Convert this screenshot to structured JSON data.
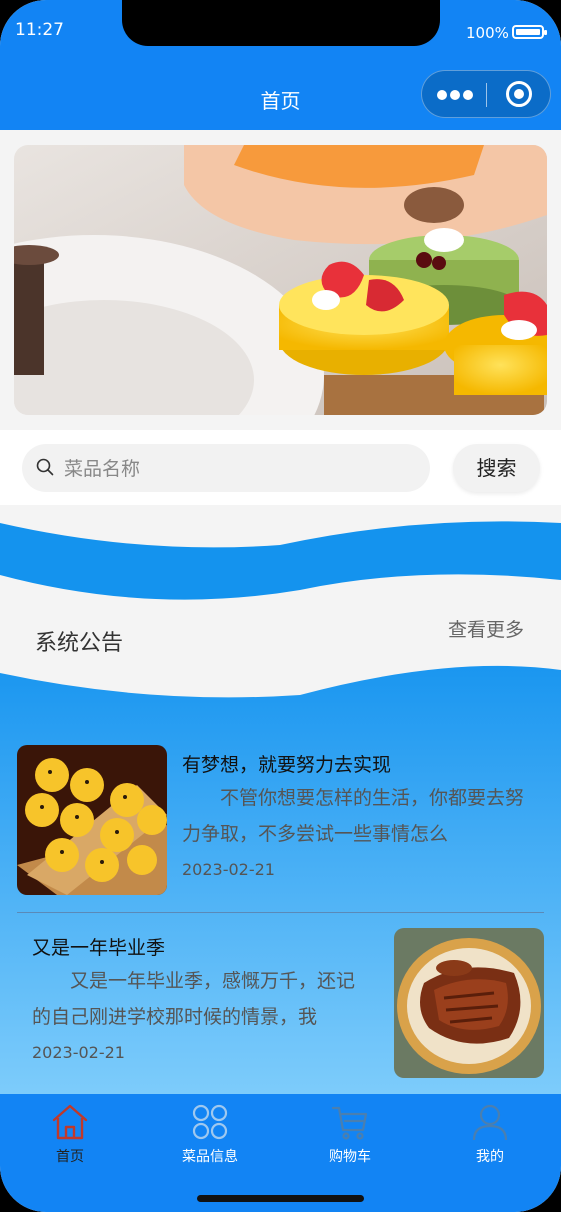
{
  "status_bar": {
    "time": "11:27",
    "battery": "100%"
  },
  "nav": {
    "title": "首页"
  },
  "search": {
    "placeholder": "菜品名称",
    "button_label": "搜索"
  },
  "notice": {
    "title": "系统公告",
    "more_label": "查看更多"
  },
  "articles": [
    {
      "title": "有梦想，就要努力去实现",
      "summary": "不管你想要怎样的生活，你都要去努力争取，不多尝试一些事情怎么",
      "date": "2023-02-21"
    },
    {
      "title": "又是一年毕业季",
      "summary": "又是一年毕业季，感慨万千，还记的自己刚进学校那时候的情景，我",
      "date": "2023-02-21"
    }
  ],
  "tabbar": {
    "items": [
      {
        "label": "首页",
        "icon": "home-icon"
      },
      {
        "label": "菜品信息",
        "icon": "grid-icon"
      },
      {
        "label": "购物车",
        "icon": "cart-icon"
      },
      {
        "label": "我的",
        "icon": "user-icon"
      }
    ],
    "active_index": 0
  },
  "colors": {
    "primary": "#1284f4",
    "active_icon": "#c0392b"
  }
}
